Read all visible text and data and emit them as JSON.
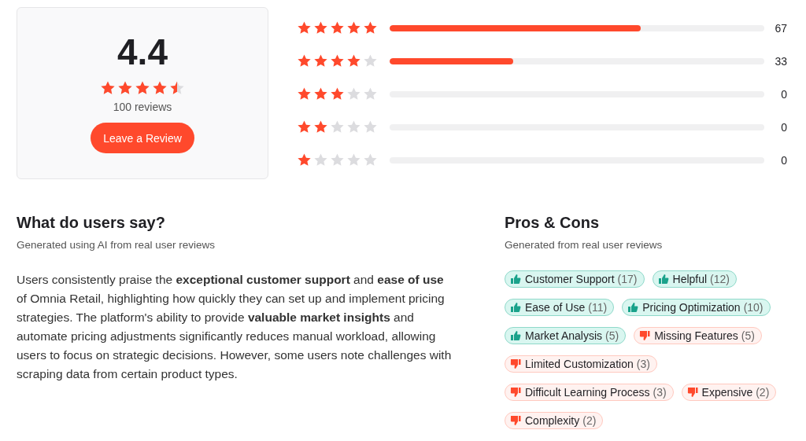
{
  "summary": {
    "score": "4.4",
    "stars": 4.5,
    "reviews_count": "100 reviews",
    "button": "Leave a Review"
  },
  "distribution": [
    {
      "stars": 5,
      "level": 0.67,
      "count": "67"
    },
    {
      "stars": 4,
      "level": 0.33,
      "count": "33"
    },
    {
      "stars": 3,
      "count": "0"
    },
    {
      "stars": 2,
      "count": "0"
    },
    {
      "stars": 1,
      "count": "0"
    }
  ],
  "users_say": {
    "title": "What do users say?",
    "subtitle": "Generated using AI from real user reviews",
    "text": "Users consistently praise the **exceptional customer support** and **ease of use** of Omnia Retail, highlighting how quickly they can set up and implement pricing strategies. The platform's ability to provide **valuable market insights** and automate pricing adjustments significantly reduces manual workload, allowing users to focus on strategic decisions. However, some users note challenges with scraping data from certain product types."
  },
  "pros_cons": {
    "title": "Pros & Cons",
    "subtitle": "Generated from real user reviews",
    "tags": [
      {
        "kind": "pro",
        "label": "Customer Support",
        "count": "(17)"
      },
      {
        "kind": "pro",
        "label": "Helpful",
        "count": "(12)"
      },
      {
        "kind": "pro",
        "label": "Ease of Use",
        "count": "(11)"
      },
      {
        "kind": "pro",
        "label": "Pricing Optimization",
        "count": "(10)"
      },
      {
        "kind": "pro",
        "label": "Market Analysis",
        "count": "(5)"
      },
      {
        "kind": "con",
        "label": "Missing Features",
        "count": "(5)"
      },
      {
        "kind": "con",
        "label": "Limited Customization",
        "count": "(3)"
      },
      {
        "kind": "con",
        "label": "Difficult Learning Process",
        "count": "(3)"
      },
      {
        "kind": "con",
        "label": "Expensive",
        "count": "(2)"
      },
      {
        "kind": "con",
        "label": "Complexity",
        "count": "(2)"
      }
    ]
  }
}
